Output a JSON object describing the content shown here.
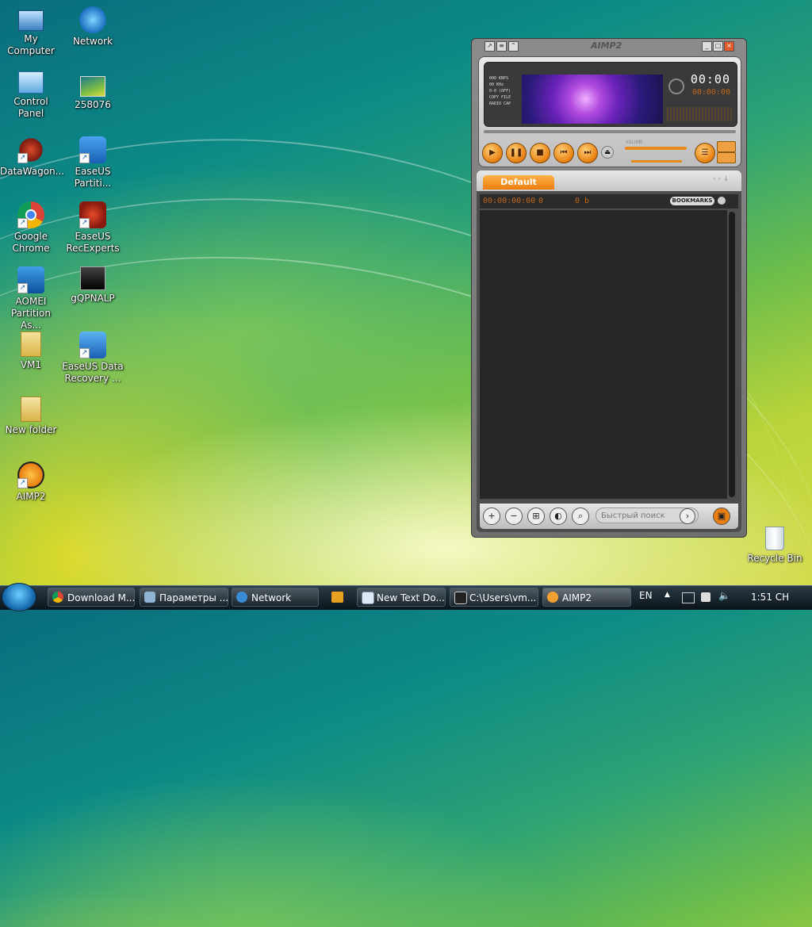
{
  "desktop": {
    "icons": [
      {
        "label": "My Computer",
        "icon": "computer-icon"
      },
      {
        "label": "Network",
        "icon": "network-icon"
      },
      {
        "label": "Control Panel",
        "icon": "control-panel-icon"
      },
      {
        "label": "258076",
        "icon": "image-file-icon"
      },
      {
        "label": "DataWagon...",
        "icon": "datawagon-icon"
      },
      {
        "label": "EaseUS Partiti...",
        "icon": "easeus-partition-icon"
      },
      {
        "label": "Google Chrome",
        "icon": "chrome-icon"
      },
      {
        "label": "EaseUS RecExperts",
        "icon": "easeus-recexperts-icon"
      },
      {
        "label": "AOMEI Partition As...",
        "icon": "aomei-icon"
      },
      {
        "label": "gQPNALP",
        "icon": "black-file-icon"
      },
      {
        "label": "VM1",
        "icon": "user-folder-icon"
      },
      {
        "label": "EaseUS Data Recovery ...",
        "icon": "easeus-recovery-icon"
      },
      {
        "label": "New folder",
        "icon": "folder-icon"
      },
      {
        "label": "AIMP2",
        "icon": "aimp-icon"
      },
      {
        "label": "Recycle Bin",
        "icon": "recycle-bin-icon"
      }
    ]
  },
  "aimp": {
    "title": "AIMP2",
    "info_lines": [
      "000 KBPS",
      "00 KHz",
      "0-0 (OFF)",
      "COPY FILE",
      "RADIO CAP"
    ],
    "time": "00:00",
    "time_total": "00:00:00",
    "volume_label": "VOLUME",
    "playlist_tab": "Default",
    "playlist_duration": "00:00:00:00",
    "playlist_count": "0",
    "playlist_size": "0 b",
    "bookmarks_label": "BOOKMARKS",
    "search_placeholder": "Быстрый поиск"
  },
  "taskbar": {
    "items": [
      {
        "label": "Download M...",
        "icon": "chrome-icon"
      },
      {
        "label": "Параметры ...",
        "icon": "settings-icon"
      },
      {
        "label": "Network",
        "icon": "network-icon"
      },
      {
        "label": "New Text Do...",
        "icon": "notepad-icon"
      },
      {
        "label": "C:\\Users\\vm...",
        "icon": "7zip-icon"
      },
      {
        "label": "AIMP2",
        "icon": "aimp-icon"
      }
    ],
    "language": "EN",
    "clock": "1:51 CH"
  },
  "colors": {
    "accent": "#f07c0d",
    "window_bg": "#7a7a7a",
    "taskbar": "#0b141b"
  }
}
